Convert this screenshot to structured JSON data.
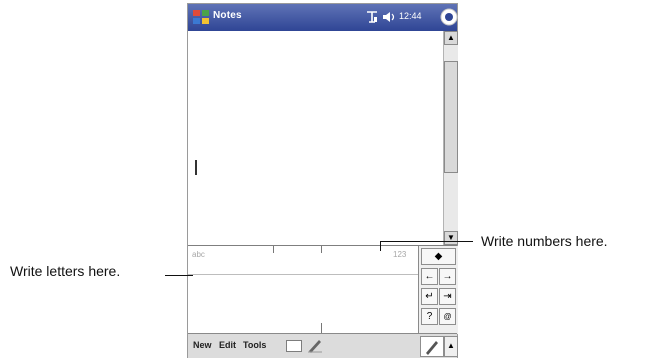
{
  "titlebar": {
    "app_title": "Notes",
    "clock": "12:44",
    "icons": [
      "start-icon",
      "connectivity-icon",
      "volume-icon",
      "ok-icon"
    ]
  },
  "input_panel": {
    "letters_label": "abc",
    "numbers_label": "123"
  },
  "menubar": {
    "items": [
      "New",
      "Edit",
      "Tools"
    ],
    "icons": [
      "keyboard-icon",
      "pen-icon",
      "input-pen-icon",
      "input-arrow-icon"
    ]
  },
  "callouts": {
    "numbers": "Write numbers here.",
    "letters": "Write letters here."
  },
  "colors": {
    "titlebar": "#3b4f9f",
    "menubar": "#dcdcdc"
  }
}
